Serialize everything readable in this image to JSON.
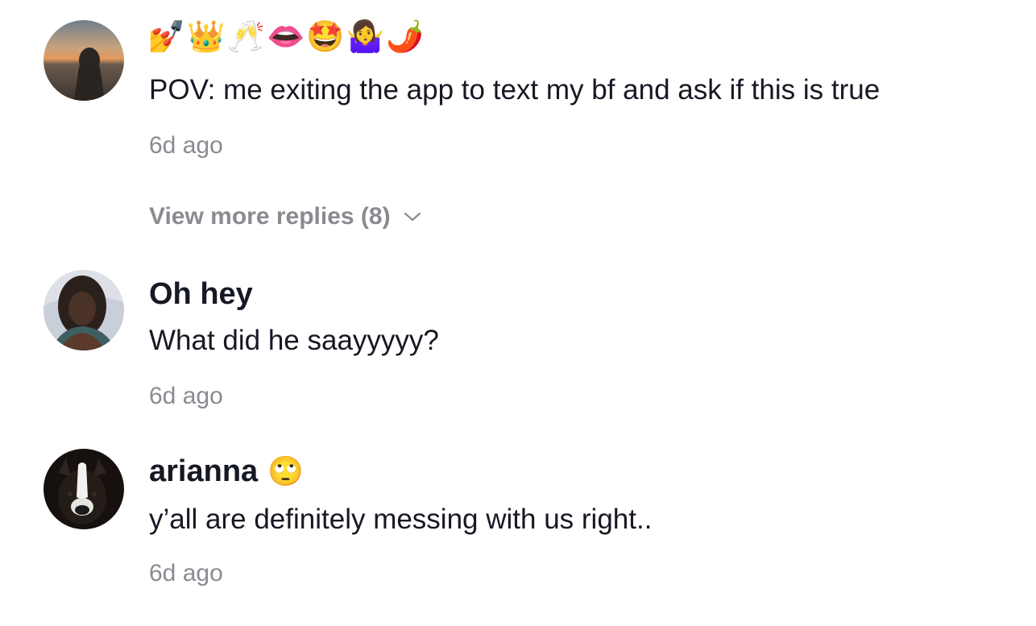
{
  "comments": [
    {
      "username_emojis": [
        "💅",
        "👑",
        "🥂",
        "👄",
        "🤩",
        "🤷‍♀️",
        "🌶️"
      ],
      "text": "POV: me exiting the app to text my bf and ask if this is true",
      "time": "6d ago",
      "avatar": "sunset-person-avatar"
    },
    {
      "username": "Oh hey",
      "text": "What did he saayyyyy?",
      "time": "6d ago",
      "avatar": "woman-portrait-avatar"
    },
    {
      "username": "arianna",
      "username_emoji": "🙄",
      "text": "y’all are definitely messing with us right..",
      "time": "6d ago",
      "avatar": "dog-avatar"
    }
  ],
  "view_more_replies": "View more replies (8)",
  "colors": {
    "primary_text": "#161823",
    "secondary_text": "#8a8b91",
    "background": "#ffffff"
  }
}
